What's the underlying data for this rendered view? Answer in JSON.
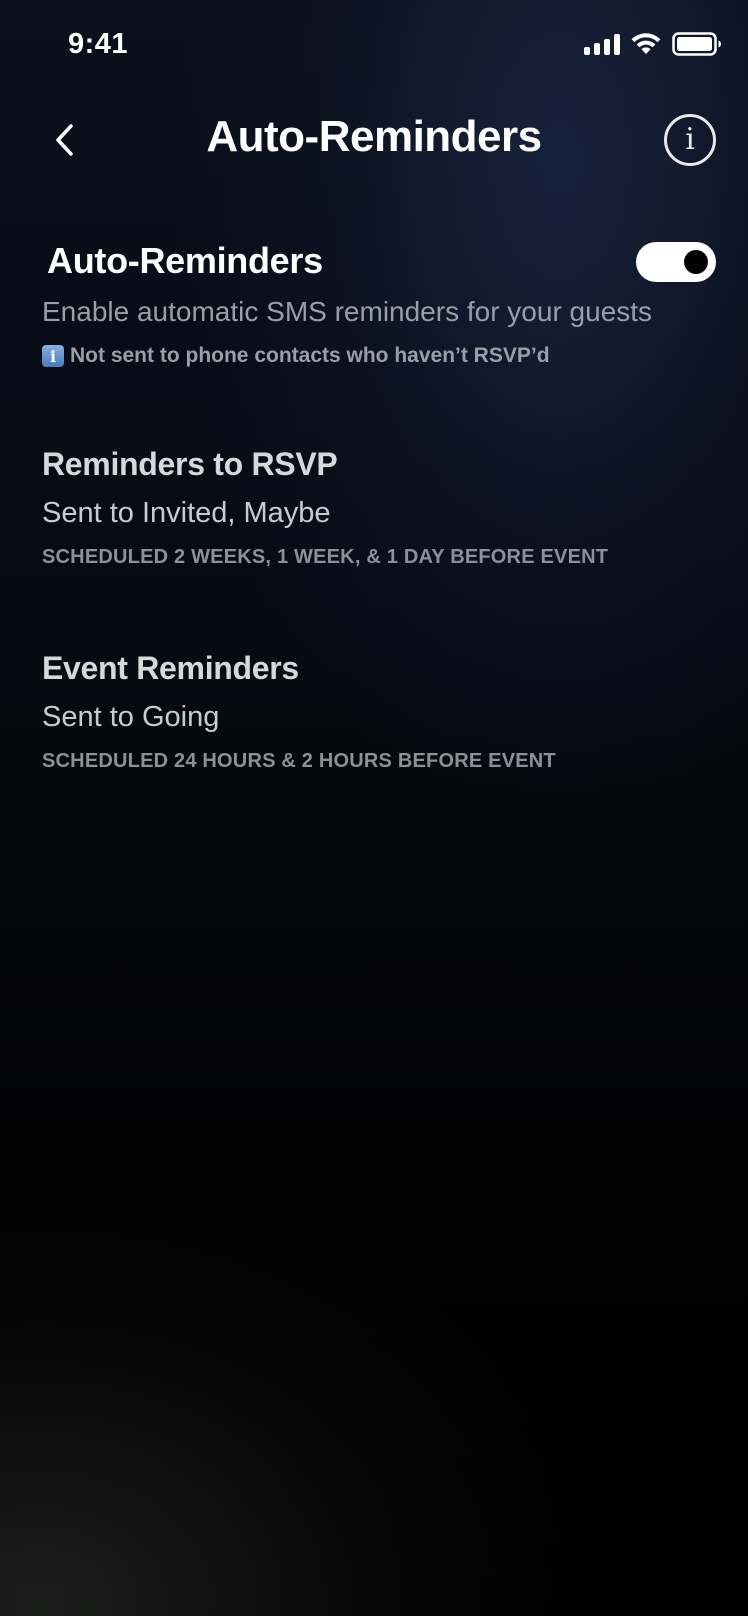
{
  "status_bar": {
    "time": "9:41",
    "icons": [
      "cellular-signal-icon",
      "wifi-icon",
      "battery-icon"
    ]
  },
  "header": {
    "back_icon": "chevron-left-icon",
    "title": "Auto-Reminders",
    "info_icon": "info-circle-icon",
    "info_glyph": "i"
  },
  "auto_reminders": {
    "title": "Auto-Reminders",
    "enabled": true,
    "description": "Enable automatic SMS reminders for your guests",
    "note_icon": "info-square-icon",
    "note_glyph": "i",
    "note": "Not sent to phone contacts who haven’t RSVP’d"
  },
  "sections": [
    {
      "title": "Reminders to RSVP",
      "recipients": "Sent to Invited, Maybe",
      "schedule": "SCHEDULED 2 WEEKS, 1 WEEK, & 1 DAY BEFORE EVENT"
    },
    {
      "title": "Event Reminders",
      "recipients": "Sent to Going",
      "schedule": "SCHEDULED 24 HOURS & 2 HOURS BEFORE EVENT"
    }
  ],
  "colors": {
    "toggle_on": "#ffffff",
    "muted_text": "#9a9ea6",
    "info_badge": "#5b8ad0"
  }
}
